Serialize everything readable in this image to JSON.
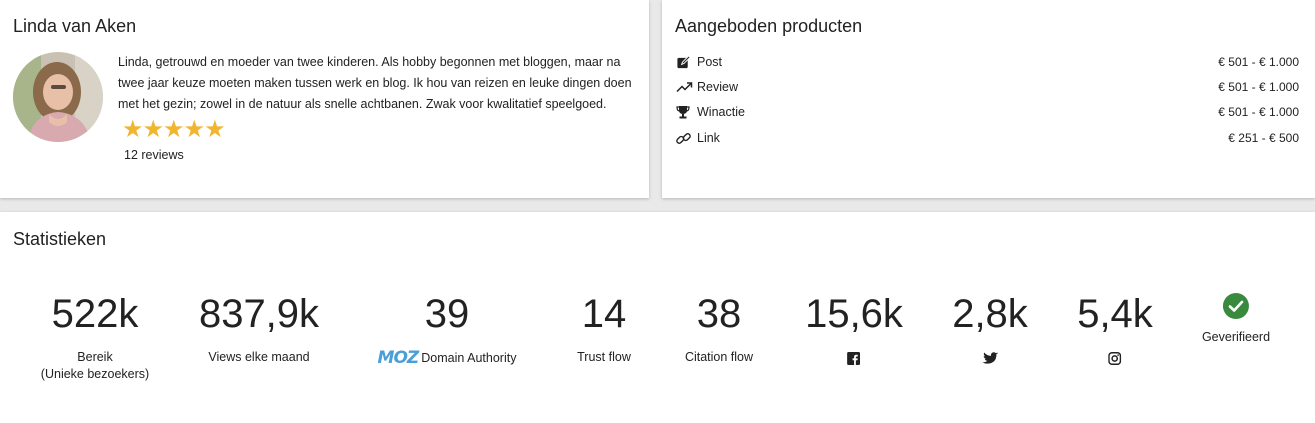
{
  "profile": {
    "name": "Linda van Aken",
    "bio": "Linda, getrouwd en moeder van twee kinderen. Als hobby begonnen met bloggen, maar na twee jaar keuze moeten maken tussen werk en blog. Ik hou van reizen en leuke dingen doen met het gezin; zowel in de natuur als snelle achtbanen. Zwak voor kwalitatief speelgoed.",
    "stars": "★★★★★",
    "rating": 5,
    "reviews": "12 reviews"
  },
  "products": {
    "title": "Aangeboden producten",
    "items": [
      {
        "icon": "edit-icon",
        "name": "Post",
        "price": "€ 501 - € 1.000"
      },
      {
        "icon": "trending-up-icon",
        "name": "Review",
        "price": "€ 501 - € 1.000"
      },
      {
        "icon": "trophy-icon",
        "name": "Winactie",
        "price": "€ 501 - € 1.000"
      },
      {
        "icon": "link-icon",
        "name": "Link",
        "price": "€ 251 - € 500"
      }
    ]
  },
  "stats": {
    "title": "Statistieken",
    "items": [
      {
        "value": "522k",
        "label_line1": "Bereik",
        "label_line2": "(Unieke bezoekers)"
      },
      {
        "value": "837,9k",
        "label": "Views elke maand"
      },
      {
        "value": "39",
        "moz": "MOZ",
        "label": "Domain Authority"
      },
      {
        "value": "14",
        "label": "Trust flow"
      },
      {
        "value": "38",
        "label": "Citation flow"
      },
      {
        "value": "15,6k",
        "icon": "facebook-icon"
      },
      {
        "value": "2,8k",
        "icon": "twitter-icon"
      },
      {
        "value": "5,4k",
        "icon": "instagram-icon"
      }
    ],
    "verified_label": "Geverifieerd"
  },
  "colors": {
    "star": "#f1b630",
    "verified": "#3a8a3e",
    "moz": "#4a9fd8"
  }
}
